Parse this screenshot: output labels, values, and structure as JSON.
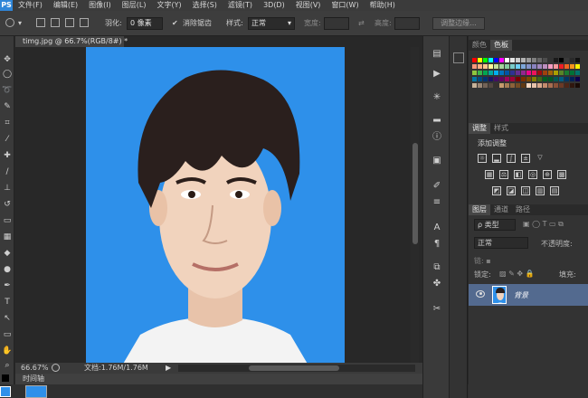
{
  "app": {
    "logo": "PS"
  },
  "menu": [
    "文件(F)",
    "编辑(E)",
    "图像(I)",
    "图层(L)",
    "文字(Y)",
    "选择(S)",
    "滤镜(T)",
    "3D(D)",
    "视图(V)",
    "窗口(W)",
    "帮助(H)"
  ],
  "options": {
    "feather_label": "羽化:",
    "feather_value": "0 像素",
    "antialias_label": "消除锯齿",
    "style_label": "样式:",
    "style_value": "正常",
    "width_label": "宽度:",
    "height_label": "高度:",
    "refine_edge_button": "调整边缘..."
  },
  "document": {
    "tab_title": "timg.jpg @ 66.7%(RGB/8#) *",
    "zoom": "66.67%",
    "doc_size": "文档:1.76M/1.76M"
  },
  "timeline": {
    "label": "时间轴"
  },
  "panels": {
    "color_tabs": [
      "颜色",
      "色板"
    ],
    "adjust_tabs": [
      "调整",
      "样式"
    ],
    "adjust_title": "添加调整",
    "layers_tabs": [
      "图层",
      "通道",
      "路径"
    ],
    "filter_kind": "ρ 类型",
    "blend_mode": "正常",
    "opacity_label": "不透明度:",
    "lock_label": "锁定:",
    "fill_label": "填充:",
    "layer_name": "背景"
  },
  "colors": {
    "canvas_bg": "#2e90ea",
    "selected_layer": "#536a8f"
  }
}
